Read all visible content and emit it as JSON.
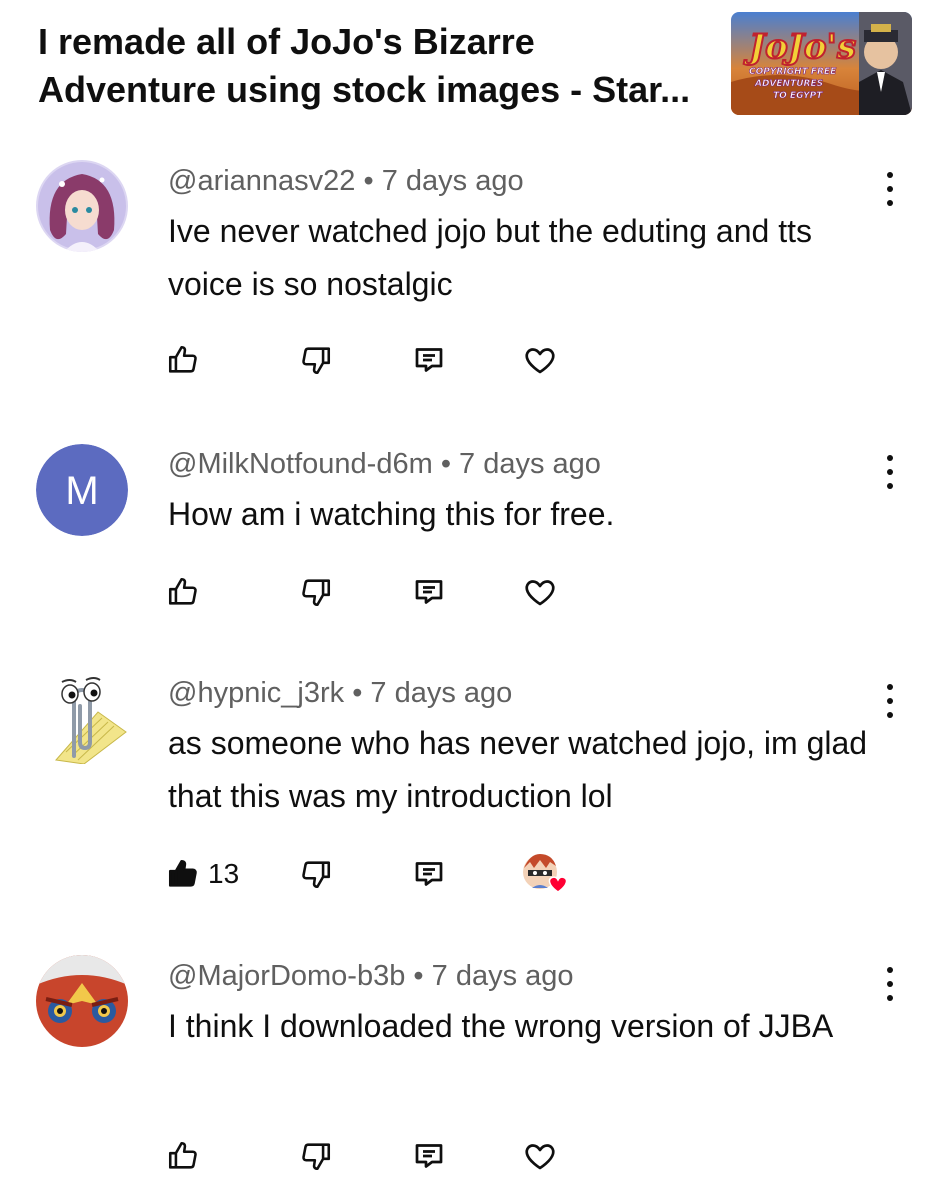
{
  "video": {
    "title_line1": "I remade all of JoJo's Bizarre",
    "title_line2": "Adventure using stock images - Star...",
    "thumbnail": {
      "logo_text": "JoJo's",
      "line1": "COPYRIGHT FREE",
      "line2": "ADVENTURES",
      "line3": "TO EGYPT"
    }
  },
  "comments": [
    {
      "handle": "@ariannasv22",
      "separator": "•",
      "time": "7 days ago",
      "text": "Ive never watched jojo but the eduting and tts voice is so nostalgic",
      "avatar": "anime-girl-avatar",
      "like_count": ""
    },
    {
      "handle": "@MilkNotfound-d6m",
      "separator": "•",
      "time": "7 days ago",
      "text": "How am i watching this for free.",
      "avatar_letter": "M",
      "avatar_color": "#5c6bc0",
      "like_count": ""
    },
    {
      "handle": "@hypnic_j3rk",
      "separator": "•",
      "time": "7 days ago",
      "text": "as someone who has never watched jojo, im glad that this was my introduction lol",
      "avatar": "clippy-avatar",
      "like_count": "13",
      "liked": true,
      "creator_heart": true
    },
    {
      "handle": "@MajorDomo-b3b",
      "separator": "•",
      "time": "7 days ago",
      "text": "I think I downloaded the wrong version of JJBA",
      "avatar": "red-bird-avatar",
      "like_count": ""
    }
  ],
  "icons": {
    "like": "thumbs-up-icon",
    "dislike": "thumbs-down-icon",
    "reply": "reply-icon",
    "heart": "heart-icon",
    "more": "more-vert-icon"
  }
}
